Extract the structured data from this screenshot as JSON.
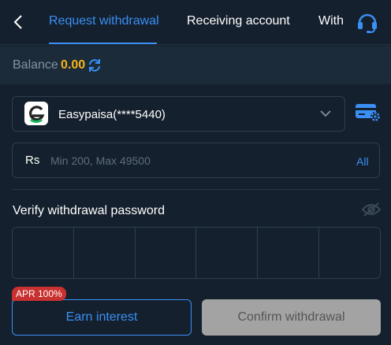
{
  "header": {
    "tabs": [
      {
        "label": "Request withdrawal",
        "active": true
      },
      {
        "label": "Receiving account",
        "active": false
      },
      {
        "label": "With",
        "active": false
      }
    ],
    "back_icon": "chevron-left-icon",
    "support_icon": "headset-icon"
  },
  "balance": {
    "label": "Balance",
    "value": "0.00",
    "refresh_icon": "refresh-icon"
  },
  "account": {
    "name": "Easypaisa(****5440)",
    "logo_icon": "easypaisa-logo",
    "dropdown_icon": "chevron-down-icon",
    "manage_icon": "card-settings-icon"
  },
  "amount": {
    "currency": "Rs",
    "placeholder": "Min 200, Max 49500",
    "value": "",
    "all_label": "All"
  },
  "password": {
    "label": "Verify withdrawal password",
    "visibility_icon": "eye-off-icon",
    "digits": [
      "",
      "",
      "",
      "",
      "",
      ""
    ]
  },
  "actions": {
    "apr_badge": "APR 100%",
    "earn_label": "Earn interest",
    "confirm_label": "Confirm withdrawal"
  },
  "colors": {
    "background": "#14202d",
    "panel": "#1c2b3a",
    "accent": "#3a8ff5",
    "balance_value": "#f5b41a",
    "badge": "#c8312f",
    "disabled_button": "#a3a3a3"
  }
}
